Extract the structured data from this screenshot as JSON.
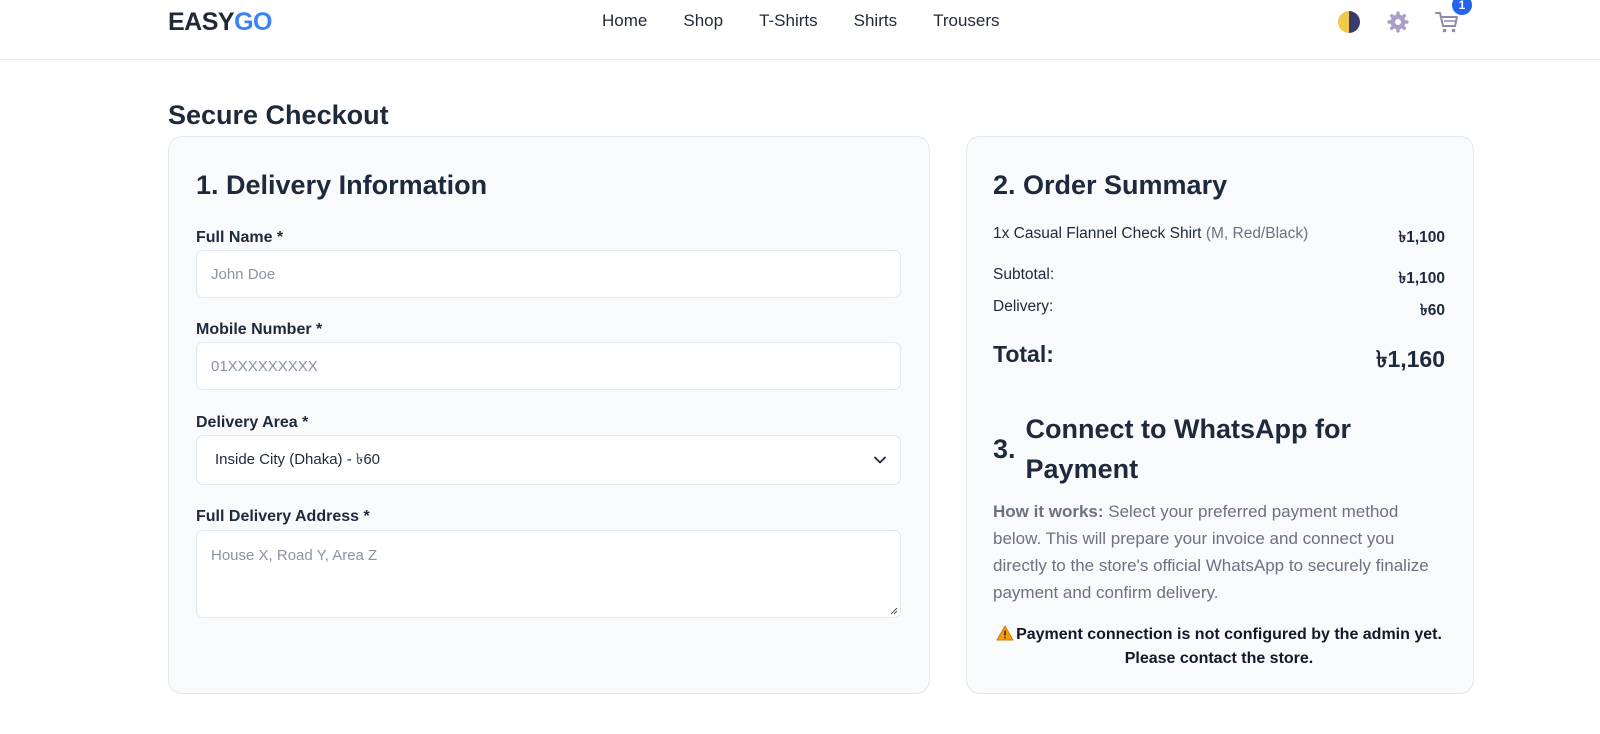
{
  "header": {
    "logo_part1": "EASY",
    "logo_part2": "GO",
    "nav": [
      "Home",
      "Shop",
      "T-Shirts",
      "Shirts",
      "Trousers"
    ],
    "cart_count": "1",
    "icons": [
      "theme-toggle-icon",
      "gear-icon",
      "cart-icon"
    ]
  },
  "page": {
    "title": "Secure Checkout"
  },
  "delivery": {
    "heading": "1. Delivery Information",
    "full_name": {
      "label": "Full Name *",
      "placeholder": "John Doe"
    },
    "mobile": {
      "label": "Mobile Number *",
      "placeholder": "01XXXXXXXXX"
    },
    "area": {
      "label": "Delivery Area *",
      "value": "Inside City (Dhaka) - ৳60"
    },
    "address": {
      "label": "Full Delivery Address *",
      "placeholder": "House X, Road Y, Area Z"
    }
  },
  "summary": {
    "heading": "2. Order Summary",
    "item": {
      "text": "1x Casual Flannel Check Shirt",
      "variant": "(M, Red/Black)",
      "amount": "৳1,100"
    },
    "subtotal": {
      "label": "Subtotal:",
      "amount": "৳1,100"
    },
    "delivery": {
      "label": "Delivery:",
      "amount": "৳60"
    },
    "total": {
      "label": "Total:",
      "amount": "৳1,160"
    }
  },
  "connect": {
    "number": "3.",
    "heading": "Connect to WhatsApp for Payment",
    "how_label": "How it works:",
    "how_text": " Select your preferred payment method below. This will prepare your invoice and connect you directly to the store's official WhatsApp to securely finalize payment and confirm delivery.",
    "warning": "Payment connection is not configured by the admin yet. Please contact the store."
  },
  "colors": {
    "brand_blue": "#3b82f6",
    "badge_blue": "#2563eb",
    "text_dark": "#1e293b",
    "muted": "#6b7280",
    "card_bg": "#f8fafc"
  }
}
